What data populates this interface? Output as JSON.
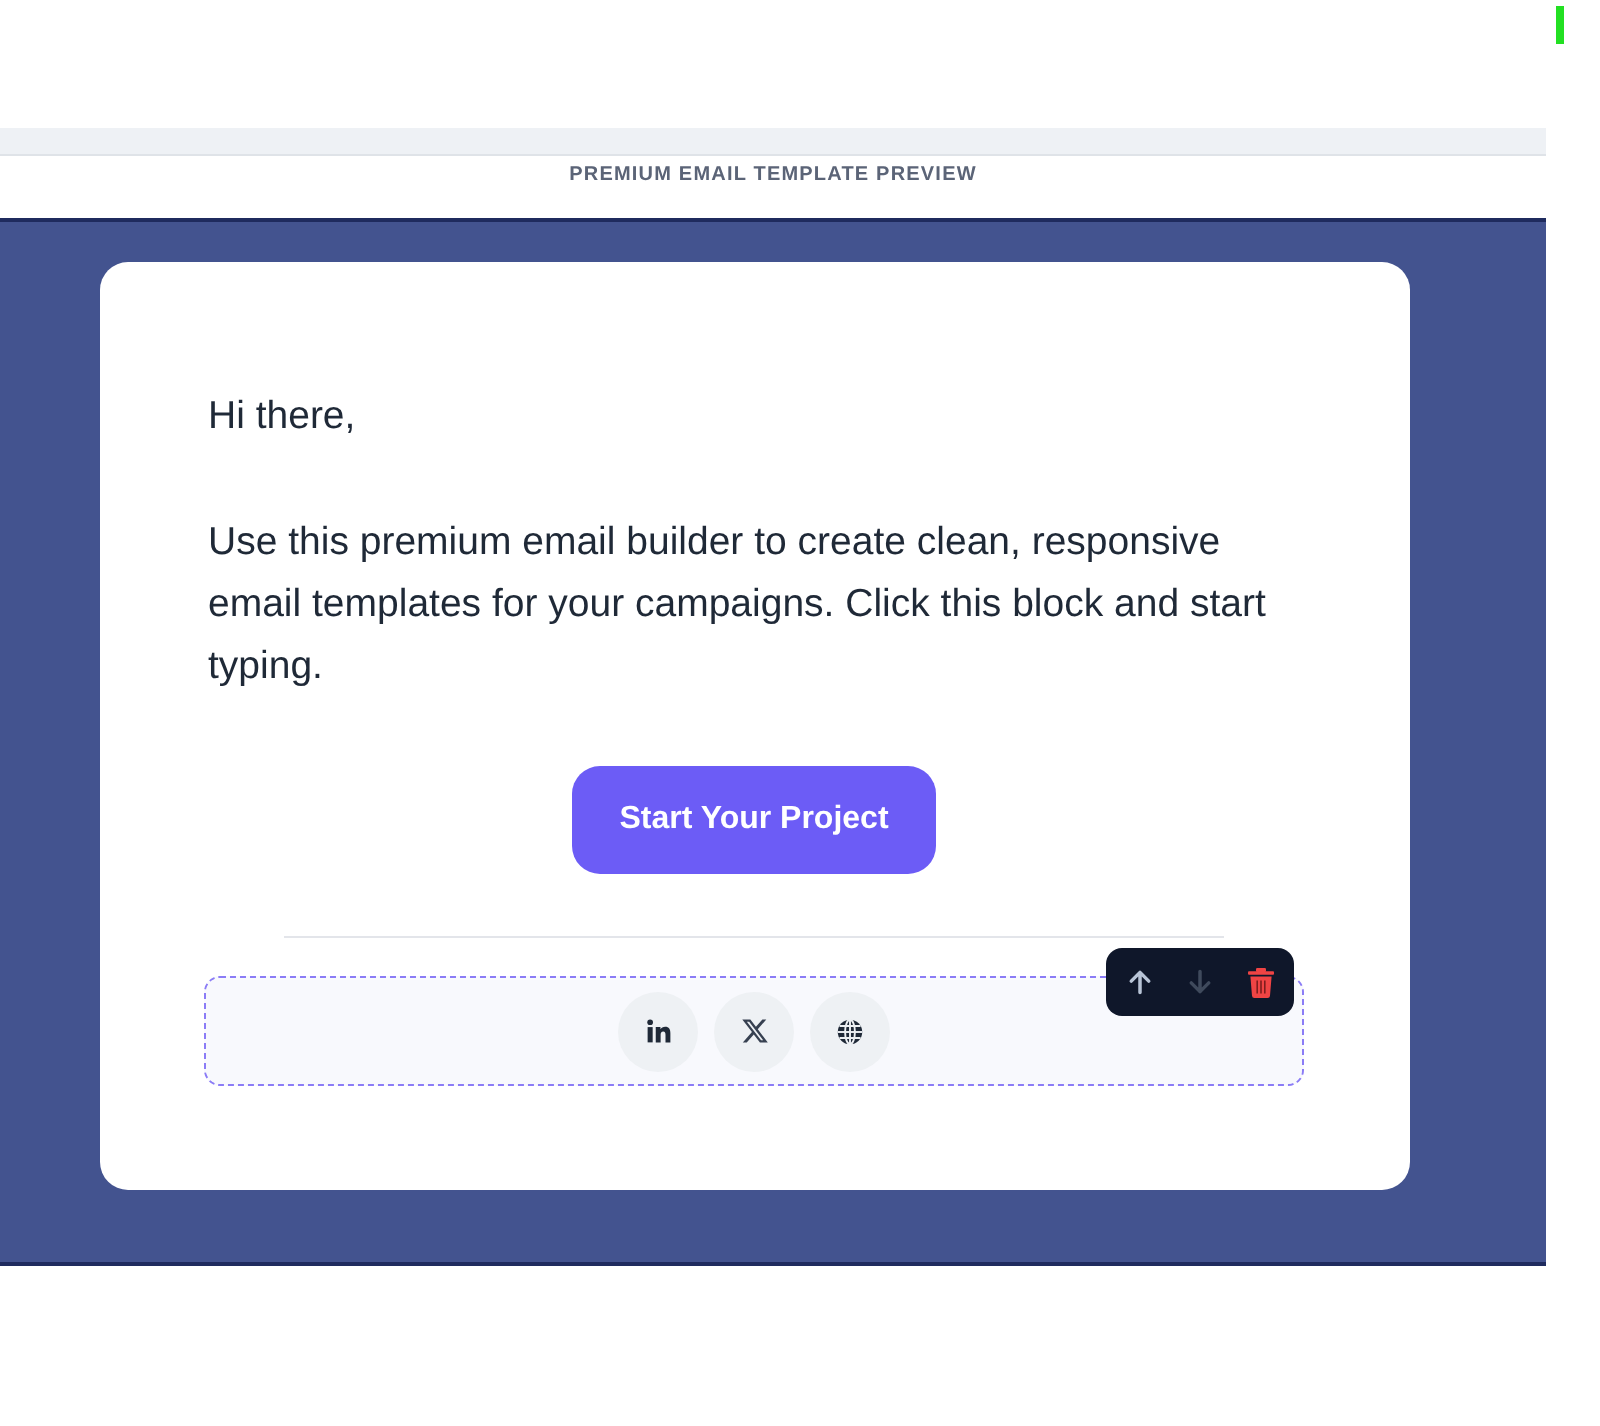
{
  "preview_header": {
    "caption": "PREMIUM EMAIL TEMPLATE PREVIEW"
  },
  "email": {
    "greeting": "Hi there,",
    "body": "Use this premium email builder to create clean, responsive email templates for your campaigns. Click this block and start typing.",
    "button": {
      "label": "Start Your Project"
    },
    "social_block": {
      "selected": true,
      "icons": [
        {
          "kind": "linkedin"
        },
        {
          "kind": "x"
        },
        {
          "kind": "globe"
        }
      ],
      "toolbar": [
        {
          "kind": "move_up",
          "disabled": false
        },
        {
          "kind": "move_down",
          "disabled": true
        },
        {
          "kind": "delete",
          "disabled": false
        }
      ]
    }
  }
}
